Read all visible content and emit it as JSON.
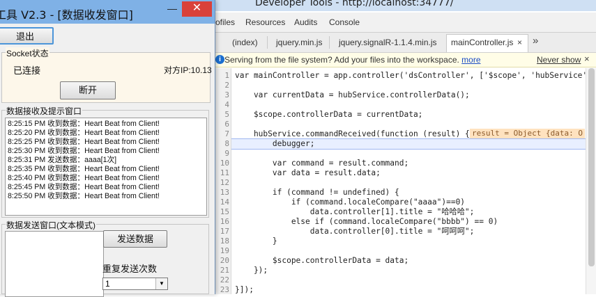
{
  "devtools": {
    "title": "Developer Tools - http://localhost:34777/",
    "panels": [
      "ofiles",
      "Resources",
      "Audits",
      "Console"
    ],
    "file_tabs": [
      "(index)",
      "jquery.min.js",
      "jquery.signalR-1.1.4.min.js",
      "mainController.js"
    ],
    "active_tab_close": "×",
    "more_tabs": "»",
    "info_bar": {
      "icon": "i",
      "text": "Serving from the file system? Add your files into the workspace.",
      "more_link": "more",
      "never_show": "Never show",
      "close": "×"
    },
    "code_lines": [
      {
        "n": "10",
        "dummy": ""
      }
    ],
    "inline_value": "result = Object {data: O"
  },
  "code": {
    "l1": "var mainController = app.controller('dsController', ['$scope', 'hubService',",
    "l2": "",
    "l3": "    var currentData = hubService.controllerData();",
    "l4": "",
    "l5": "    $scope.controllerData = currentData;",
    "l6": "",
    "l7": "    hubService.commandReceived(function (result) {",
    "l8": "        debugger;",
    "l9": "",
    "l10": "        var command = result.command;",
    "l11": "        var data = result.data;",
    "l12": "",
    "l13": "        if (command != undefined) {",
    "l14": "            if (command.localeCompare(\"aaaa\")==0)",
    "l15": "                data.controller[1].title = \"哈哈哈\";",
    "l16": "            else if (command.localeCompare(\"bbbb\") == 0)",
    "l17": "                data.controller[0].title = \"呵呵呵\";",
    "l18": "        }",
    "l19": "",
    "l20": "        $scope.controllerData = data;",
    "l21": "    });",
    "l22": "",
    "l23": "}]);"
  },
  "app": {
    "title": "工具 V2.3 - [数据收发窗口]",
    "minimize": "—",
    "close": "✕",
    "exit_button": "退出",
    "socket_group": {
      "label": "Socket状态",
      "status": "已连接",
      "peer_ip": "对方IP:10.13",
      "disconnect_button": "断开"
    },
    "recv_group": {
      "label": "数据接收及提示窗口",
      "log": [
        "8:25:15 PM 收到数据：Heart Beat from Client!",
        "8:25:20 PM 收到数据：Heart Beat from Client!",
        "8:25:25 PM 收到数据：Heart Beat from Client!",
        "8:25:30 PM 收到数据：Heart Beat from Client!",
        "8:25:31 PM 发送数据：aaaa[1次]",
        "8:25:35 PM 收到数据：Heart Beat from Client!",
        "8:25:40 PM 收到数据：Heart Beat from Client!",
        "8:25:45 PM 收到数据：Heart Beat from Client!",
        "8:25:50 PM 收到数据：Heart Beat from Client!"
      ]
    },
    "send_group": {
      "label": "数据发送窗口(文本模式)",
      "send_button": "发送数据",
      "repeat_label": "重复发送次数",
      "repeat_value": "1"
    }
  }
}
